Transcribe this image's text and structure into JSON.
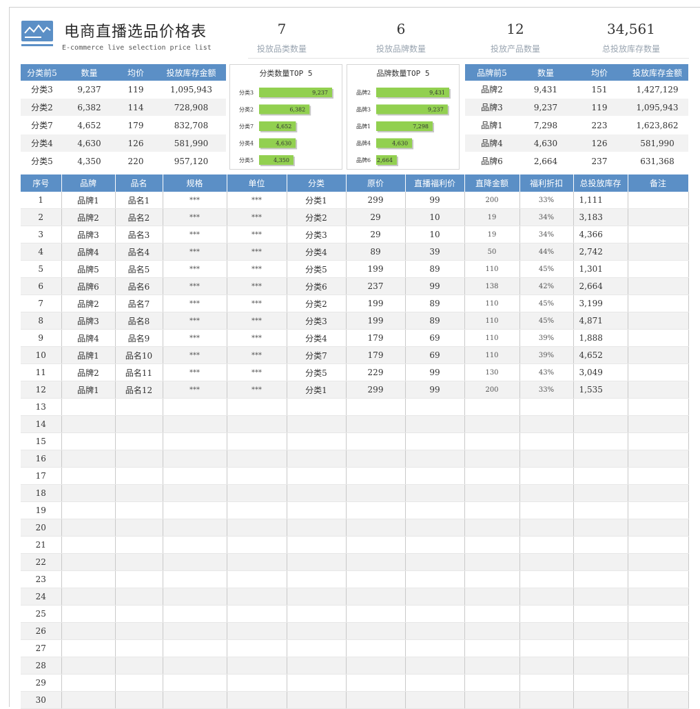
{
  "header": {
    "title": "电商直播选品价格表",
    "subtitle": "E-commerce live selection price list",
    "kpis": [
      {
        "value": "7",
        "label": "投放品类数量"
      },
      {
        "value": "6",
        "label": "投放品牌数量"
      },
      {
        "value": "12",
        "label": "投放产品数量"
      },
      {
        "value": "34,561",
        "label": "总投放库存数量"
      }
    ]
  },
  "colors": {
    "header_blue": "#5b8fc6",
    "bar_green": "#92d050"
  },
  "category_top5": {
    "headers": [
      "分类前5",
      "数量",
      "均价",
      "投放库存金额"
    ],
    "rows": [
      [
        "分类3",
        "9,237",
        "119",
        "1,095,943"
      ],
      [
        "分类2",
        "6,382",
        "114",
        "728,908"
      ],
      [
        "分类7",
        "4,652",
        "179",
        "832,708"
      ],
      [
        "分类4",
        "4,630",
        "126",
        "581,990"
      ],
      [
        "分类5",
        "4,350",
        "220",
        "957,120"
      ]
    ]
  },
  "brand_top5": {
    "headers": [
      "品牌前5",
      "数量",
      "均价",
      "投放库存金额"
    ],
    "rows": [
      [
        "品牌2",
        "9,431",
        "151",
        "1,427,129"
      ],
      [
        "品牌3",
        "9,237",
        "119",
        "1,095,943"
      ],
      [
        "品牌1",
        "7,298",
        "223",
        "1,623,862"
      ],
      [
        "品牌4",
        "4,630",
        "126",
        "581,990"
      ],
      [
        "品牌6",
        "2,664",
        "237",
        "631,368"
      ]
    ]
  },
  "chart_data": [
    {
      "type": "bar",
      "title": "分类数量TOP 5",
      "categories": [
        "分类3",
        "分类2",
        "分类7",
        "分类4",
        "分类5"
      ],
      "values": [
        9237,
        6382,
        4652,
        4630,
        4350
      ],
      "value_labels": [
        "9,237",
        "6,382",
        "4,652",
        "4,630",
        "4,350"
      ]
    },
    {
      "type": "bar",
      "title": "品牌数量TOP 5",
      "categories": [
        "品牌2",
        "品牌3",
        "品牌1",
        "品牌4",
        "品牌6"
      ],
      "values": [
        9431,
        9237,
        7298,
        4630,
        2664
      ],
      "value_labels": [
        "9,431",
        "9,237",
        "7,298",
        "4,630",
        "2,664"
      ]
    }
  ],
  "main_table": {
    "headers": [
      "序号",
      "品牌",
      "品名",
      "规格",
      "单位",
      "分类",
      "原价",
      "直播福利价",
      "直降金额",
      "福利折扣",
      "总投放库存",
      "备注"
    ],
    "rows": [
      [
        "1",
        "品牌1",
        "品名1",
        "***",
        "***",
        "分类1",
        "299",
        "99",
        "200",
        "33%",
        "1,111",
        ""
      ],
      [
        "2",
        "品牌2",
        "品名2",
        "***",
        "***",
        "分类2",
        "29",
        "10",
        "19",
        "34%",
        "3,183",
        ""
      ],
      [
        "3",
        "品牌3",
        "品名3",
        "***",
        "***",
        "分类3",
        "29",
        "10",
        "19",
        "34%",
        "4,366",
        ""
      ],
      [
        "4",
        "品牌4",
        "品名4",
        "***",
        "***",
        "分类4",
        "89",
        "39",
        "50",
        "44%",
        "2,742",
        ""
      ],
      [
        "5",
        "品牌5",
        "品名5",
        "***",
        "***",
        "分类5",
        "199",
        "89",
        "110",
        "45%",
        "1,301",
        ""
      ],
      [
        "6",
        "品牌6",
        "品名6",
        "***",
        "***",
        "分类6",
        "237",
        "99",
        "138",
        "42%",
        "2,664",
        ""
      ],
      [
        "7",
        "品牌2",
        "品名7",
        "***",
        "***",
        "分类2",
        "199",
        "89",
        "110",
        "45%",
        "3,199",
        ""
      ],
      [
        "8",
        "品牌3",
        "品名8",
        "***",
        "***",
        "分类3",
        "199",
        "89",
        "110",
        "45%",
        "4,871",
        ""
      ],
      [
        "9",
        "品牌4",
        "品名9",
        "***",
        "***",
        "分类4",
        "179",
        "69",
        "110",
        "39%",
        "1,888",
        ""
      ],
      [
        "10",
        "品牌1",
        "品名10",
        "***",
        "***",
        "分类7",
        "179",
        "69",
        "110",
        "39%",
        "4,652",
        ""
      ],
      [
        "11",
        "品牌2",
        "品名11",
        "***",
        "***",
        "分类5",
        "229",
        "99",
        "130",
        "43%",
        "3,049",
        ""
      ],
      [
        "12",
        "品牌1",
        "品名12",
        "***",
        "***",
        "分类1",
        "299",
        "99",
        "200",
        "33%",
        "1,535",
        ""
      ],
      [
        "13",
        "",
        "",
        "",
        "",
        "",
        "",
        "",
        "",
        "",
        "",
        ""
      ],
      [
        "14",
        "",
        "",
        "",
        "",
        "",
        "",
        "",
        "",
        "",
        "",
        ""
      ],
      [
        "15",
        "",
        "",
        "",
        "",
        "",
        "",
        "",
        "",
        "",
        "",
        ""
      ],
      [
        "16",
        "",
        "",
        "",
        "",
        "",
        "",
        "",
        "",
        "",
        "",
        ""
      ],
      [
        "17",
        "",
        "",
        "",
        "",
        "",
        "",
        "",
        "",
        "",
        "",
        ""
      ],
      [
        "18",
        "",
        "",
        "",
        "",
        "",
        "",
        "",
        "",
        "",
        "",
        ""
      ],
      [
        "19",
        "",
        "",
        "",
        "",
        "",
        "",
        "",
        "",
        "",
        "",
        ""
      ],
      [
        "20",
        "",
        "",
        "",
        "",
        "",
        "",
        "",
        "",
        "",
        "",
        ""
      ],
      [
        "21",
        "",
        "",
        "",
        "",
        "",
        "",
        "",
        "",
        "",
        "",
        ""
      ],
      [
        "22",
        "",
        "",
        "",
        "",
        "",
        "",
        "",
        "",
        "",
        "",
        ""
      ],
      [
        "23",
        "",
        "",
        "",
        "",
        "",
        "",
        "",
        "",
        "",
        "",
        ""
      ],
      [
        "24",
        "",
        "",
        "",
        "",
        "",
        "",
        "",
        "",
        "",
        "",
        ""
      ],
      [
        "25",
        "",
        "",
        "",
        "",
        "",
        "",
        "",
        "",
        "",
        "",
        ""
      ],
      [
        "26",
        "",
        "",
        "",
        "",
        "",
        "",
        "",
        "",
        "",
        "",
        ""
      ],
      [
        "27",
        "",
        "",
        "",
        "",
        "",
        "",
        "",
        "",
        "",
        "",
        ""
      ],
      [
        "28",
        "",
        "",
        "",
        "",
        "",
        "",
        "",
        "",
        "",
        "",
        ""
      ],
      [
        "29",
        "",
        "",
        "",
        "",
        "",
        "",
        "",
        "",
        "",
        "",
        ""
      ],
      [
        "30",
        "",
        "",
        "",
        "",
        "",
        "",
        "",
        "",
        "",
        "",
        ""
      ]
    ]
  }
}
